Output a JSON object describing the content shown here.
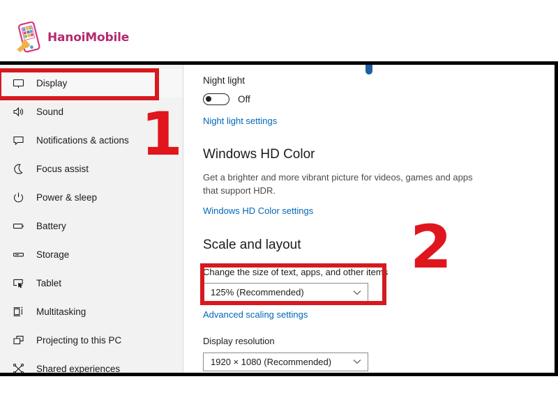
{
  "brand": {
    "name": "HanoiMobile",
    "color": "#b52a6f",
    "icon": "smartphone-repair-logo-icon"
  },
  "sidebar": {
    "items": [
      {
        "label": "Display",
        "icon": "monitor-icon",
        "selected": true
      },
      {
        "label": "Sound",
        "icon": "speaker-icon",
        "selected": false
      },
      {
        "label": "Notifications & actions",
        "icon": "notification-icon",
        "selected": false
      },
      {
        "label": "Focus assist",
        "icon": "moon-icon",
        "selected": false
      },
      {
        "label": "Power & sleep",
        "icon": "power-icon",
        "selected": false
      },
      {
        "label": "Battery",
        "icon": "battery-icon",
        "selected": false
      },
      {
        "label": "Storage",
        "icon": "storage-icon",
        "selected": false
      },
      {
        "label": "Tablet",
        "icon": "tablet-icon",
        "selected": false
      },
      {
        "label": "Multitasking",
        "icon": "multitasking-icon",
        "selected": false
      },
      {
        "label": "Projecting to this PC",
        "icon": "projecting-icon",
        "selected": false
      },
      {
        "label": "Shared experiences",
        "icon": "shared-experiences-icon",
        "selected": false
      }
    ]
  },
  "main": {
    "night_light": {
      "label": "Night light",
      "toggle_state": "Off",
      "link": "Night light settings"
    },
    "hd_color": {
      "title": "Windows HD Color",
      "description": "Get a brighter and more vibrant picture for videos, games and apps that support HDR.",
      "link": "Windows HD Color settings"
    },
    "scale_layout": {
      "title": "Scale and layout",
      "scale_label": "Change the size of text, apps, and other items",
      "scale_value": "125% (Recommended)",
      "advanced_link": "Advanced scaling settings",
      "resolution_label": "Display resolution",
      "resolution_value": "1920 × 1080 (Recommended)"
    }
  },
  "annotations": {
    "color": "#d71920",
    "step_one": "1",
    "step_two": "2"
  }
}
